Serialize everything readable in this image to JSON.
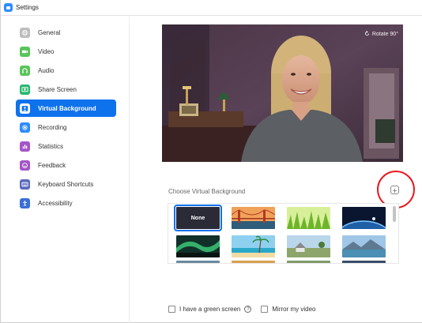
{
  "window": {
    "title": "Settings"
  },
  "sidebar": {
    "items": [
      {
        "label": "General",
        "icon": "gear-icon",
        "color": "#bdbdbd"
      },
      {
        "label": "Video",
        "icon": "video-camera-icon",
        "color": "#58c45a"
      },
      {
        "label": "Audio",
        "icon": "headphones-icon",
        "color": "#58c45a"
      },
      {
        "label": "Share Screen",
        "icon": "share-screen-icon",
        "color": "#27b86f"
      },
      {
        "label": "Virtual Background",
        "icon": "person-background-icon",
        "color": "#0e72ed",
        "active": true
      },
      {
        "label": "Recording",
        "icon": "record-icon",
        "color": "#2d8cff"
      },
      {
        "label": "Statistics",
        "icon": "bar-chart-icon",
        "color": "#a455c9"
      },
      {
        "label": "Feedback",
        "icon": "smiley-icon",
        "color": "#a455c9"
      },
      {
        "label": "Keyboard Shortcuts",
        "icon": "keyboard-icon",
        "color": "#5c6bc0"
      },
      {
        "label": "Accessibility",
        "icon": "accessibility-icon",
        "color": "#3b6fd6"
      }
    ]
  },
  "preview": {
    "rotate_label": "Rotate 90°"
  },
  "virtual_background": {
    "section_label": "Choose Virtual Background",
    "add_button_icon": "plus-icon",
    "thumbnails": [
      {
        "label": "None",
        "kind": "none"
      },
      {
        "label": "",
        "kind": "golden-gate-bridge"
      },
      {
        "label": "",
        "kind": "grass"
      },
      {
        "label": "",
        "kind": "earth-from-space"
      },
      {
        "label": "",
        "kind": "aurora"
      },
      {
        "label": "",
        "kind": "beach"
      },
      {
        "label": "",
        "kind": "house-field"
      },
      {
        "label": "",
        "kind": "mountain-lake"
      }
    ]
  },
  "options": {
    "green_screen_label": "I have a green screen",
    "mirror_label": "Mirror my video",
    "green_screen_checked": false,
    "mirror_checked": false
  },
  "colors": {
    "accent": "#0e72ed",
    "highlight_circle": "#e8191f"
  }
}
